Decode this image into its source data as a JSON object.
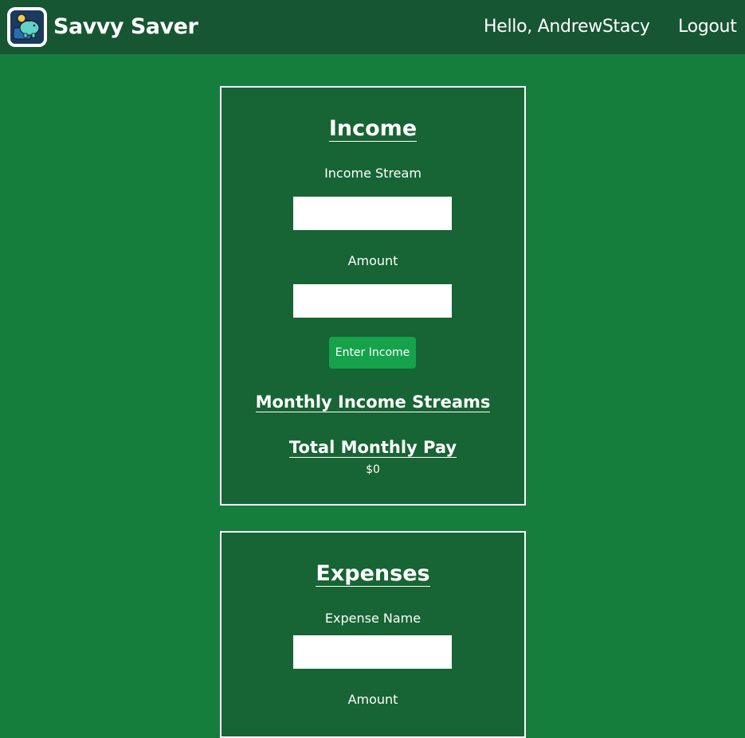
{
  "navbar": {
    "brand_name": "Savvy Saver",
    "greeting": "Hello, AndrewStacy",
    "logout_label": "Logout",
    "logo_icon": "piggy-bank-wallet-icon"
  },
  "income": {
    "title": "Income",
    "stream_label": "Income Stream",
    "stream_value": "",
    "amount_label": "Amount",
    "amount_value": "",
    "enter_button_label": "Enter Income",
    "streams_title": "Monthly Income Streams",
    "total_title": "Total Monthly Pay",
    "total_value": "$0"
  },
  "expenses": {
    "title": "Expenses",
    "name_label": "Expense Name",
    "name_value": "",
    "amount_label": "Amount"
  },
  "colors": {
    "page_background": "#157e3d",
    "navbar_background": "#175632",
    "card_background": "#176434",
    "button_background": "#16a24a",
    "text": "#ffffff"
  }
}
